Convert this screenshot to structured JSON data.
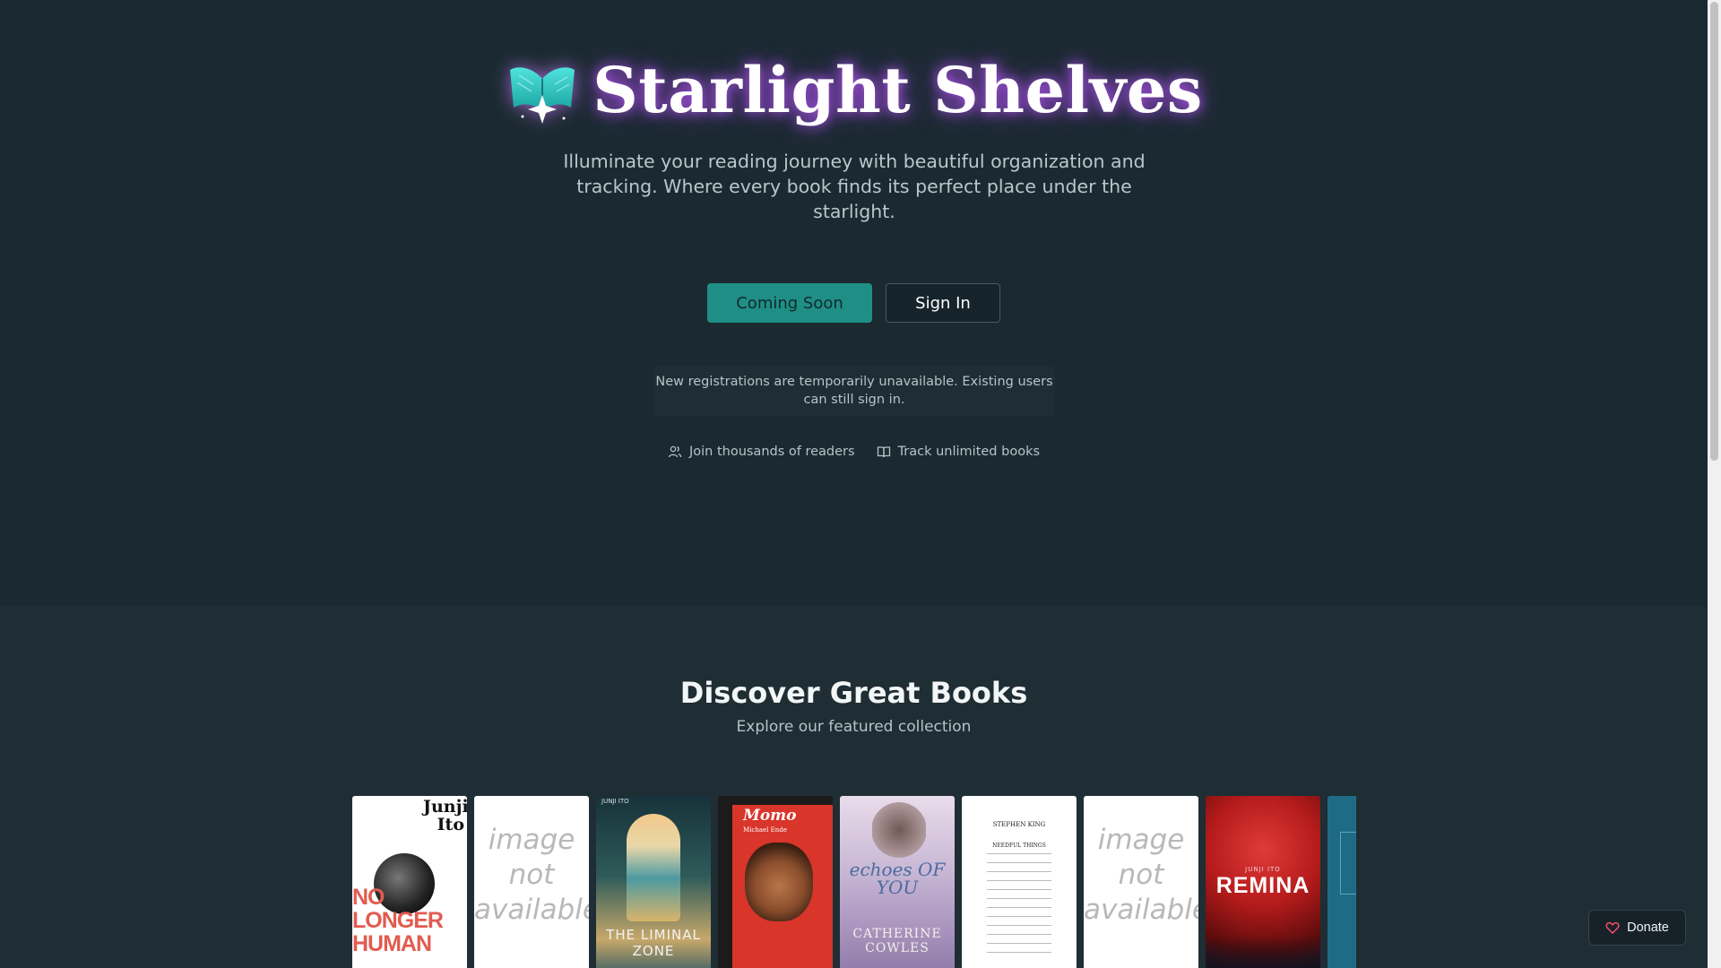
{
  "brand": {
    "title": "Starlight Shelves",
    "logo_icon": "open-book-star-icon"
  },
  "hero": {
    "tagline": "Illuminate your reading journey with beautiful organization and tracking. Where every book finds its perfect place under the starlight.",
    "primary_button": "Coming Soon",
    "secondary_button": "Sign In",
    "notice": "New registrations are temporarily unavailable. Existing users can still sign in.",
    "features": [
      {
        "icon": "users-icon",
        "label": "Join thousands of readers"
      },
      {
        "icon": "book-open-icon",
        "label": "Track unlimited books"
      }
    ]
  },
  "discover": {
    "title": "Discover Great Books",
    "subtitle": "Explore our featured collection",
    "books": [
      {
        "title": "NO LONGER HUMAN",
        "author": "Junji Ito"
      },
      {
        "title": "image not available"
      },
      {
        "title": "THE LIMINAL ZONE",
        "author": "JUNJI ITO"
      },
      {
        "title": "Momo",
        "author": "Michael Ende"
      },
      {
        "title": "echoes OF YOU",
        "author": "CATHERINE COWLES"
      },
      {
        "title": "NEEDFUL THINGS",
        "author": "STEPHEN KING"
      },
      {
        "title": "image not available"
      },
      {
        "title": "REMINA",
        "author": "JUNJI ITO"
      }
    ]
  },
  "donate": {
    "label": "Donate",
    "icon": "heart-icon"
  },
  "colors": {
    "accent": "#1f8f86",
    "background": "#1b2a31",
    "glow": "#b45cff"
  }
}
